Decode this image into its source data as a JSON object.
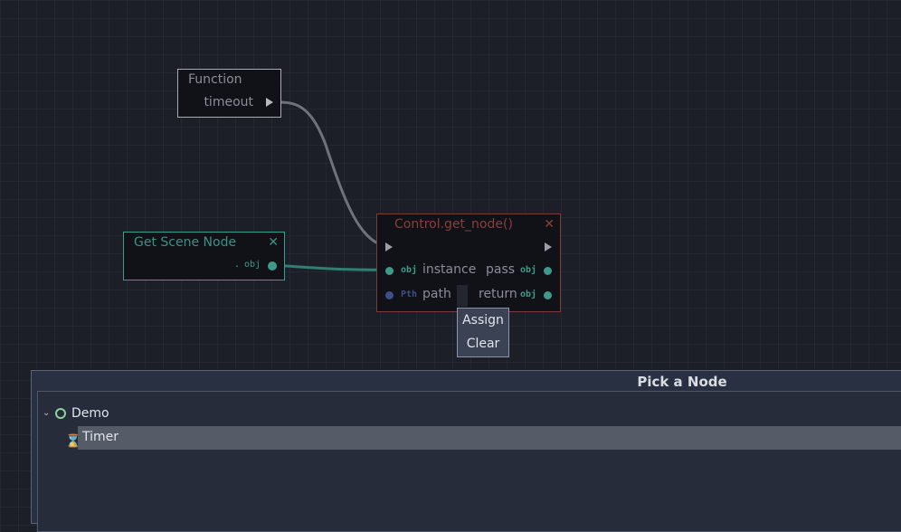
{
  "nodes": {
    "function": {
      "title": "Function",
      "output_label": "timeout"
    },
    "get_scene_node": {
      "title": "Get Scene Node",
      "close_glyph": "✕",
      "value_text": ".",
      "output_type": "obj"
    },
    "control_get_node": {
      "title": "Control.get_node()",
      "close_glyph": "✕",
      "inputs": [
        {
          "type": "obj",
          "label": "instance"
        },
        {
          "type": "Pth",
          "label": "path"
        }
      ],
      "outputs": [
        {
          "type": "obj",
          "label": "pass"
        },
        {
          "type": "obj",
          "label": "return"
        }
      ]
    }
  },
  "context_menu": {
    "items": [
      "Assign",
      "Clear"
    ]
  },
  "dialog": {
    "title": "Pick a Node",
    "tree": {
      "root": {
        "label": "Demo",
        "icon": "circle-node-icon",
        "expanded": true
      },
      "children": [
        {
          "label": "Timer",
          "icon": "hourglass-icon",
          "selected": true
        }
      ]
    }
  },
  "colors": {
    "background": "#1c1f27",
    "object_port": "#3f9a8b",
    "path_port": "#3d4f86",
    "control_title": "#8a3f3a",
    "dialog_bg": "#283042",
    "selection": "#555b67"
  }
}
